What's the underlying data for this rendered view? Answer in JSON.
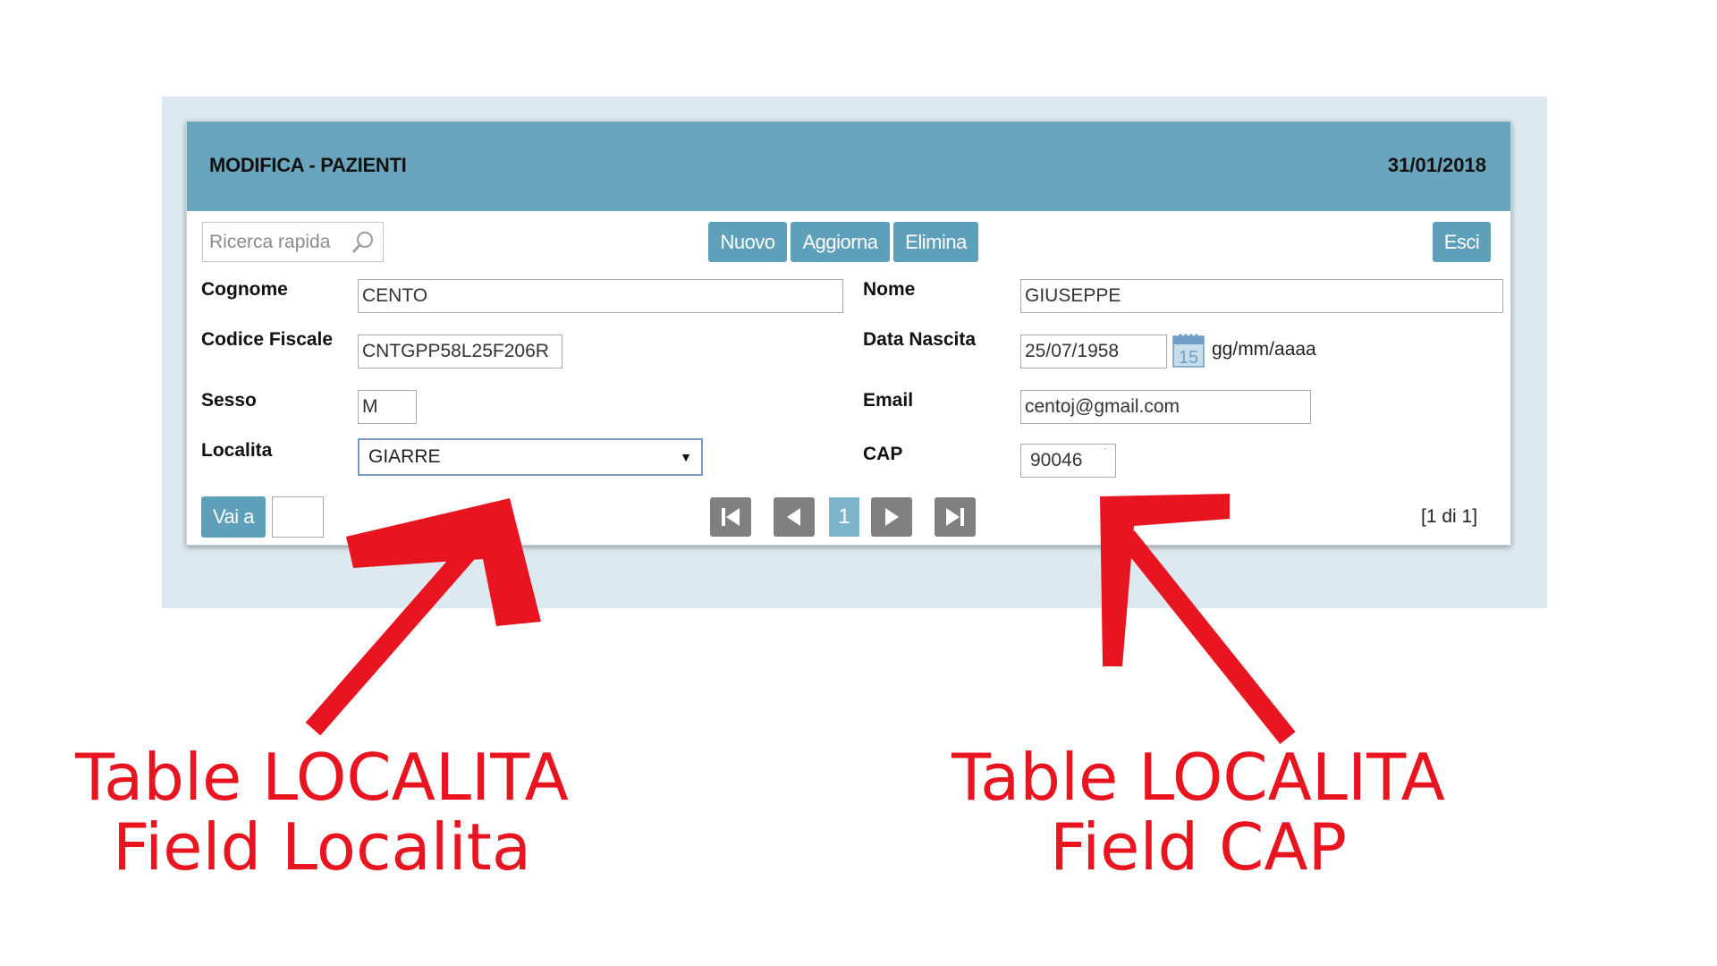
{
  "window": {
    "title": "MODIFICA - PAZIENTI",
    "date": "31/01/2018"
  },
  "toolbar": {
    "search_placeholder": "Ricerca rapida",
    "new_label": "Nuovo",
    "update_label": "Aggiorna",
    "delete_label": "Elimina",
    "exit_label": "Esci"
  },
  "form": {
    "cognome": {
      "label": "Cognome",
      "value": "CENTO"
    },
    "nome": {
      "label": "Nome",
      "value": "GIUSEPPE"
    },
    "codice_fiscale": {
      "label": "Codice Fiscale",
      "value": "CNTGPP58L25F206R"
    },
    "data_nascita": {
      "label": "Data Nascita",
      "value": "25/07/1958",
      "format_hint": "gg/mm/aaaa",
      "calendar_day": "15"
    },
    "sesso": {
      "label": "Sesso",
      "value": "M"
    },
    "email": {
      "label": "Email",
      "value": "centoj@gmail.com"
    },
    "localita": {
      "label": "Localita",
      "value": "GIARRE"
    },
    "cap": {
      "label": "CAP",
      "value": "90046"
    }
  },
  "footer": {
    "goto_label": "Vai a",
    "current_page": "1",
    "page_count": "[1 di 1]"
  },
  "annotations": {
    "left": {
      "line1": "Table LOCALITA",
      "line2": "Field Localita"
    },
    "right": {
      "line1": "Table LOCALITA",
      "line2": "Field CAP"
    }
  },
  "colors": {
    "header": "#69a6bd",
    "button": "#5e9fb9",
    "backdrop": "#dde9f1",
    "annotation": "#e8141f"
  }
}
